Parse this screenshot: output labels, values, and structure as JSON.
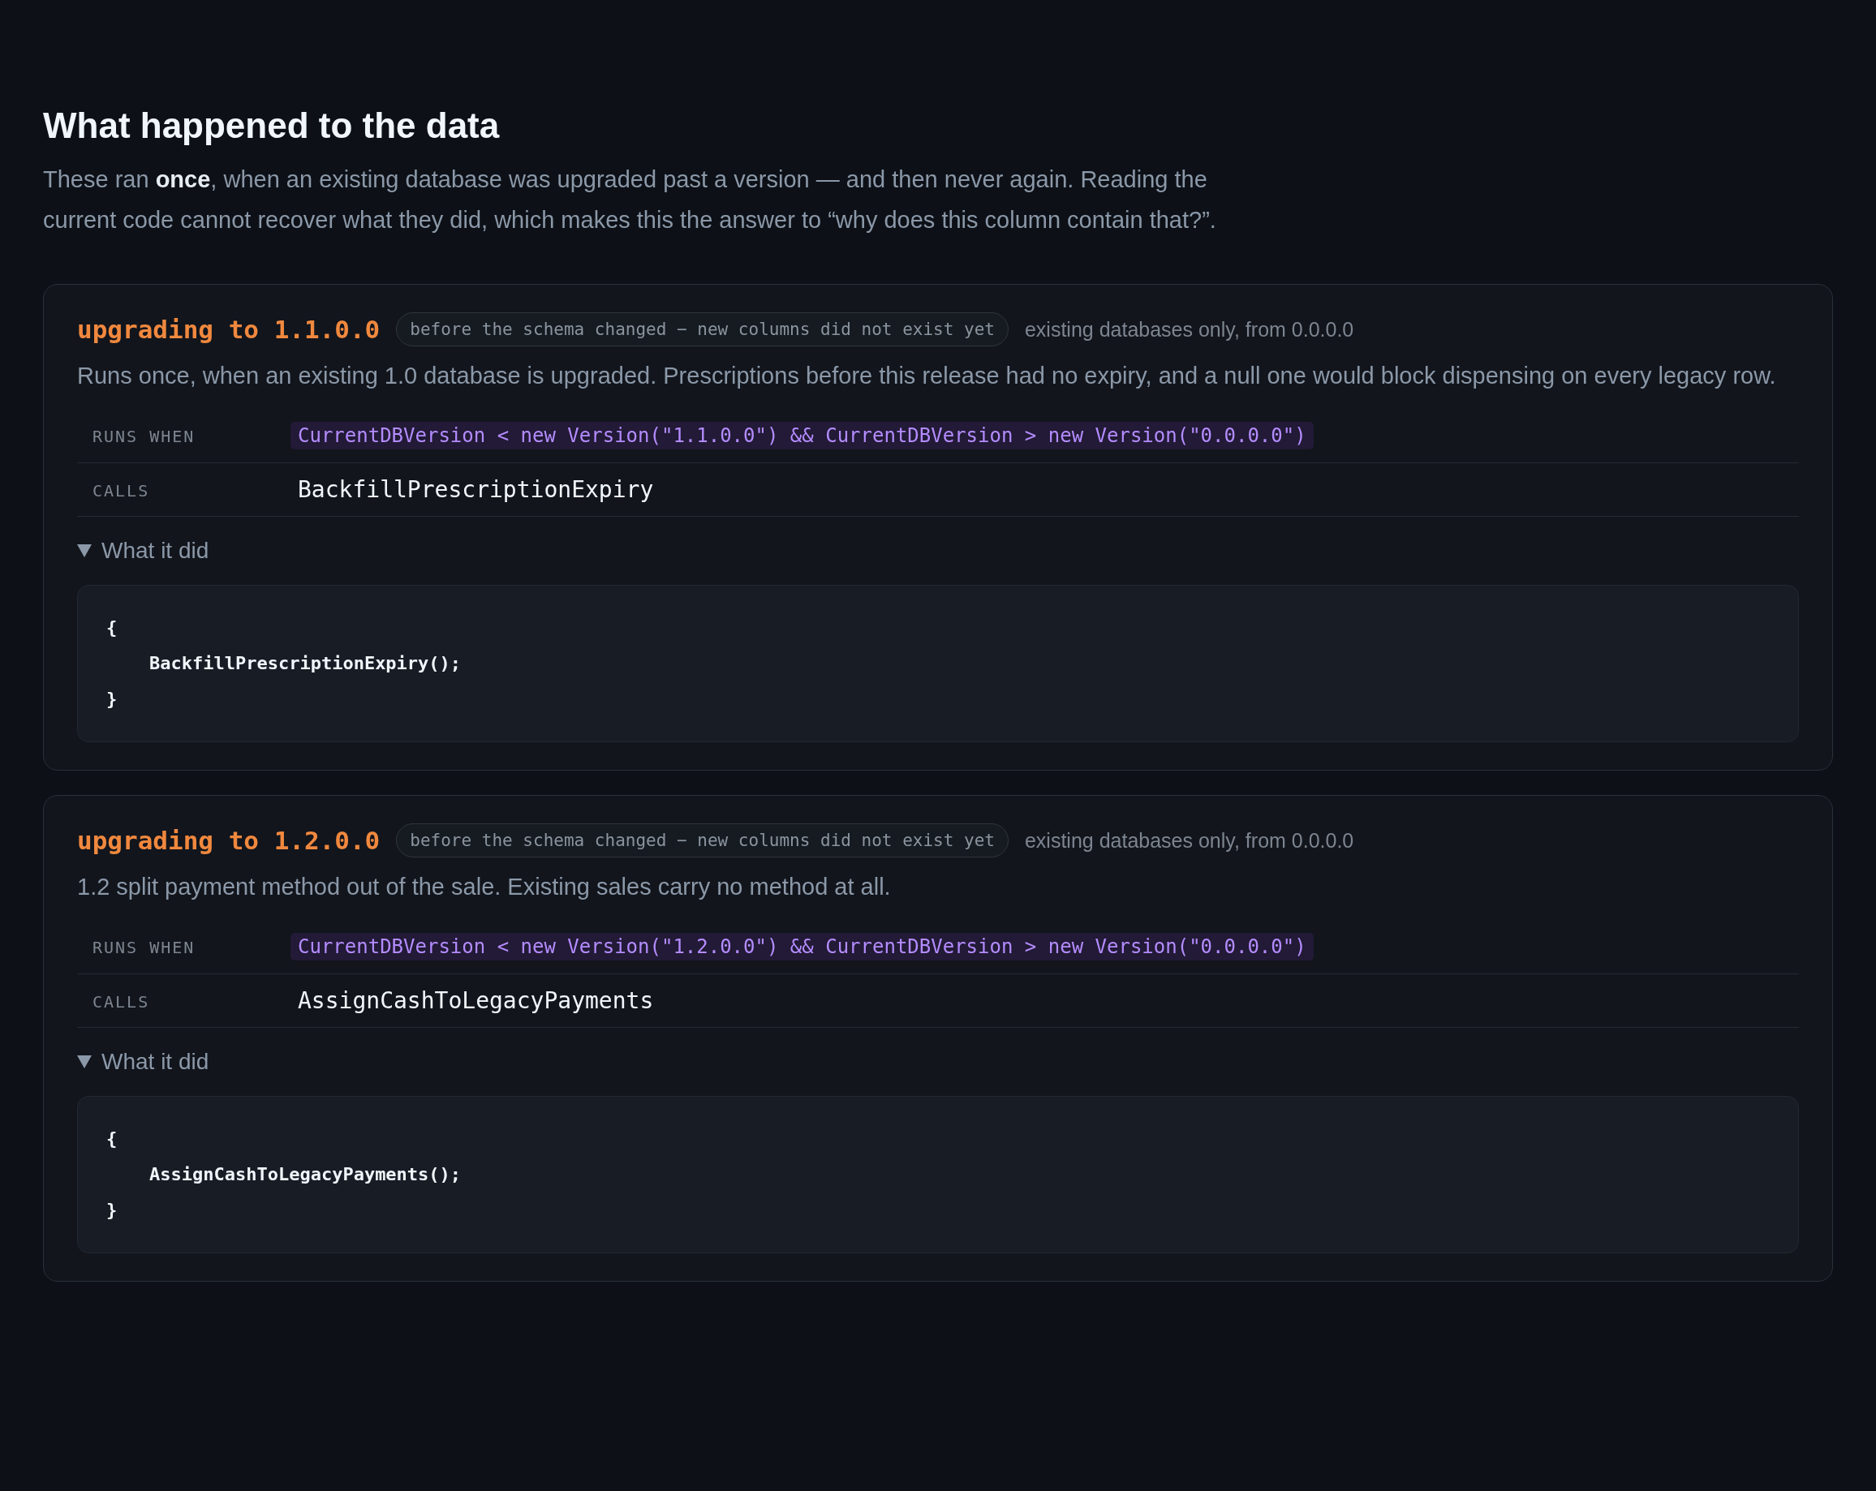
{
  "heading": "What happened to the data",
  "intro": "These ran **once**, when an existing database was upgraded past a version — and then never again. Reading the current code cannot recover what they did, which makes this the answer to “why does this column contain that?”.",
  "migrations": [
    {
      "title": "upgrading to 1.1.0.0",
      "badge": "before the schema changed − new columns did not exist yet",
      "scope": "existing databases only, from 0.0.0.0",
      "description": "Runs once, when an existing 1.0 database is upgraded. Prescriptions before this release had no expiry, and a null one would block dispensing on every legacy row.",
      "rows": [
        {
          "kind": "condition",
          "label": "RUNS WHEN",
          "value": "CurrentDBVersion < new Version(\"1.1.0.0\") && CurrentDBVersion > new Version(\"0.0.0.0\")"
        },
        {
          "kind": "call",
          "label": "CALLS",
          "value": "BackfillPrescriptionExpiry"
        }
      ],
      "details": {
        "summary": "What it did",
        "expanded": true,
        "code": [
          "{",
          "    BackfillPrescriptionExpiry();",
          "}"
        ]
      }
    },
    {
      "title": "upgrading to 1.2.0.0",
      "badge": "before the schema changed − new columns did not exist yet",
      "scope": "existing databases only, from 0.0.0.0",
      "description": "1.2 split payment method out of the sale. Existing sales carry no method at all.",
      "rows": [
        {
          "kind": "condition",
          "label": "RUNS WHEN",
          "value": "CurrentDBVersion < new Version(\"1.2.0.0\") && CurrentDBVersion > new Version(\"0.0.0.0\")"
        },
        {
          "kind": "call",
          "label": "CALLS",
          "value": "AssignCashToLegacyPayments"
        }
      ],
      "details": {
        "summary": "What it did",
        "expanded": true,
        "code": [
          "{",
          "    AssignCashToLegacyPayments();",
          "}"
        ]
      }
    }
  ]
}
